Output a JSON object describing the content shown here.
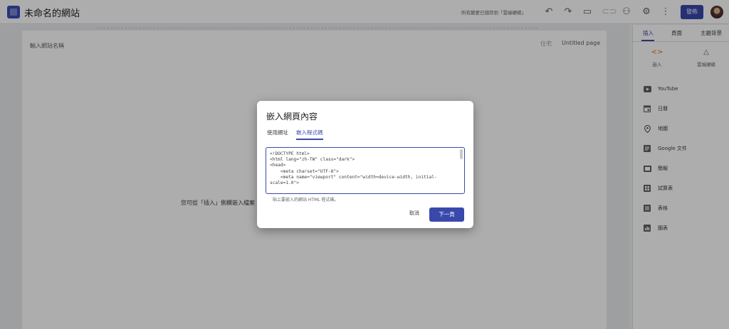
{
  "topbar": {
    "site_title": "未命名的網站",
    "save_status": "所有變更已儲存到「雲端硬碟」",
    "publish_label": "發佈"
  },
  "page": {
    "site_name_placeholder": "輸入網站名稱",
    "nav": {
      "home": "住宅",
      "untitled": "Untitled page"
    },
    "empty_hint": "您可從「插入」側欄嵌入檔案"
  },
  "panel": {
    "tabs": [
      "插入",
      "頁面",
      "主題背景"
    ],
    "quick_actions": [
      {
        "label": "嵌入",
        "icon": "code-icon"
      },
      {
        "label": "雲端硬碟",
        "icon": "drive-icon"
      }
    ],
    "items": [
      {
        "label": "YouTube",
        "icon": "youtube-icon"
      },
      {
        "label": "日曆",
        "icon": "calendar-icon"
      },
      {
        "label": "地圖",
        "icon": "map-pin-icon"
      },
      {
        "label": "Google 文件",
        "icon": "docs-icon"
      },
      {
        "label": "簡報",
        "icon": "slides-icon"
      },
      {
        "label": "試算表",
        "icon": "sheets-icon"
      },
      {
        "label": "表格",
        "icon": "forms-icon"
      },
      {
        "label": "圖表",
        "icon": "chart-icon"
      }
    ]
  },
  "dialog": {
    "title": "嵌入網頁內容",
    "tabs": [
      "使用網址",
      "嵌入程式碼"
    ],
    "active_tab": "嵌入程式碼",
    "code_value": "<!DOCTYPE html>\n<html lang=\"zh-TW\" class=\"dark\">\n<head>\n    <meta charset=\"UTF-8\">\n    <meta name=\"viewport\" content=\"width=device-width, initial-scale=1.0\">",
    "helper_text": "貼上要嵌入的網站 HTML 程式碼。",
    "cancel_label": "取消",
    "next_label": "下一頁"
  },
  "colors": {
    "accent": "#3949ab",
    "scrim": "rgba(0,0,0,0.32)"
  }
}
